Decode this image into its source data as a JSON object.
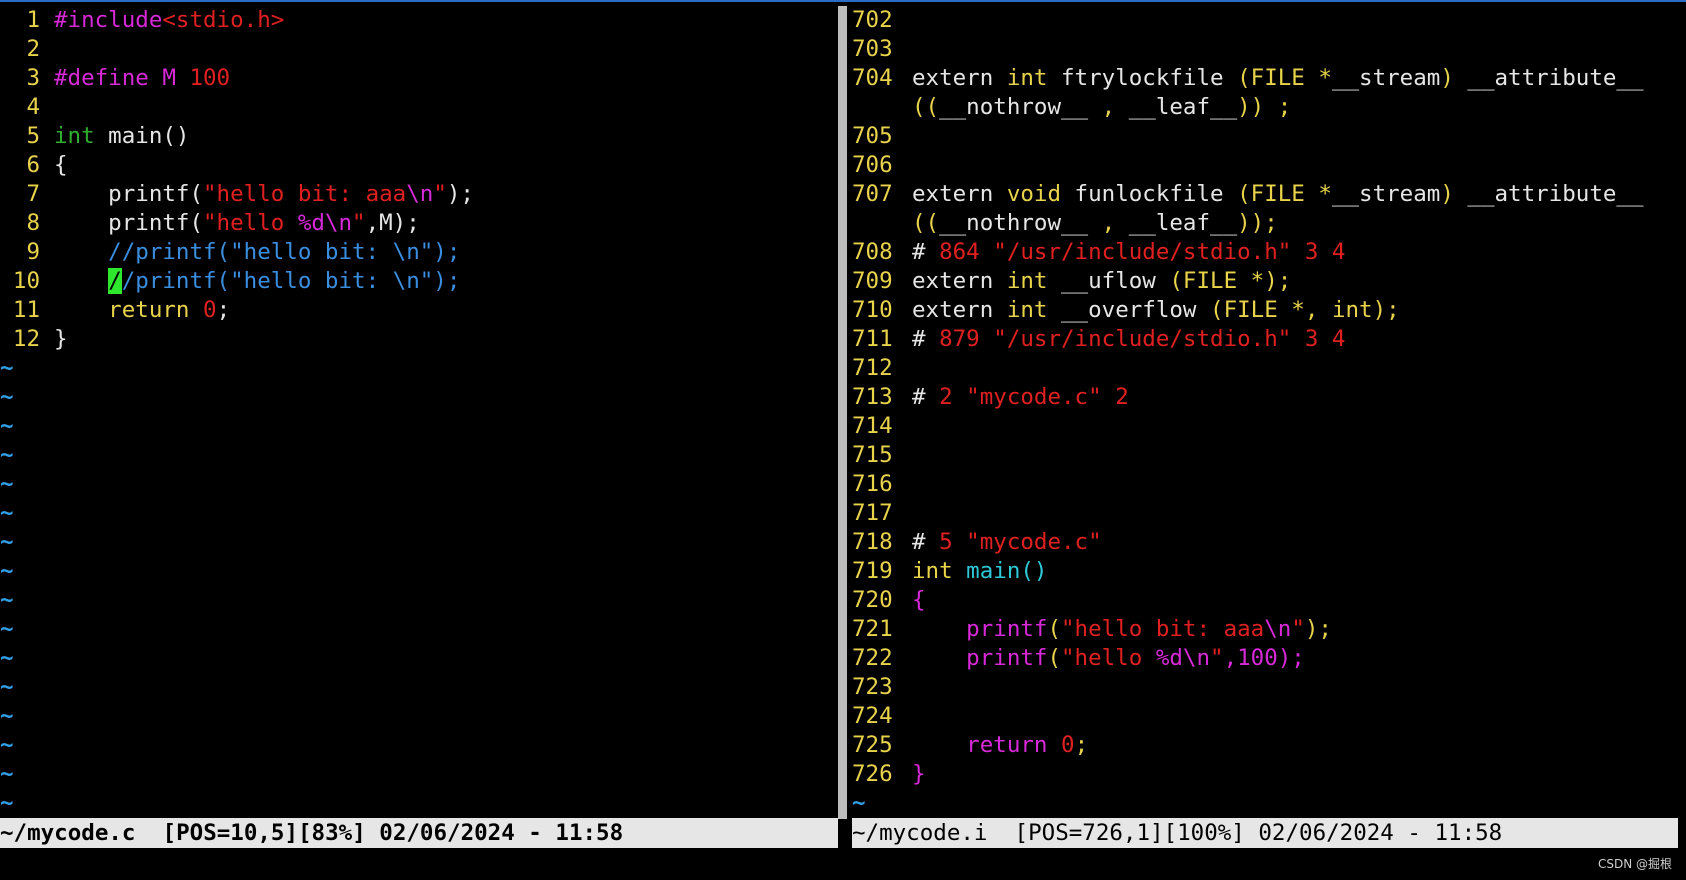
{
  "colors": {
    "line_number": "#e8d34a",
    "preproc": "#d829d8",
    "string": "#e02020",
    "type": "#2fae2f",
    "comment": "#3a8ee0",
    "keyword": "#e8d34a",
    "number": "#e02020",
    "func": "#d829d8",
    "cyan": "#2ec8d8",
    "text": "#e6e6e6",
    "tilde": "#32a0e8",
    "cursor": "#2ee82e"
  },
  "left_pane": {
    "lines": [
      {
        "n": "1",
        "tokens": [
          {
            "t": "#include",
            "c": "preproc"
          },
          {
            "t": "<stdio.h>",
            "c": "string"
          }
        ]
      },
      {
        "n": "2",
        "tokens": []
      },
      {
        "n": "3",
        "tokens": [
          {
            "t": "#define ",
            "c": "preproc"
          },
          {
            "t": "M ",
            "c": "preproc"
          },
          {
            "t": "100",
            "c": "string"
          }
        ]
      },
      {
        "n": "4",
        "tokens": []
      },
      {
        "n": "5",
        "tokens": [
          {
            "t": "int",
            "c": "type"
          },
          {
            "t": " main()",
            "c": "text"
          }
        ]
      },
      {
        "n": "6",
        "tokens": [
          {
            "t": "{",
            "c": "text"
          }
        ]
      },
      {
        "n": "7",
        "tokens": [
          {
            "t": "    printf(",
            "c": "text"
          },
          {
            "t": "\"hello bit: aaa",
            "c": "string"
          },
          {
            "t": "\\n",
            "c": "preproc"
          },
          {
            "t": "\"",
            "c": "string"
          },
          {
            "t": ");",
            "c": "text"
          }
        ]
      },
      {
        "n": "8",
        "tokens": [
          {
            "t": "    printf(",
            "c": "text"
          },
          {
            "t": "\"hello ",
            "c": "string"
          },
          {
            "t": "%d\\n",
            "c": "preproc"
          },
          {
            "t": "\"",
            "c": "string"
          },
          {
            "t": ",M);",
            "c": "text"
          }
        ]
      },
      {
        "n": "9",
        "tokens": [
          {
            "t": "    //printf(\"hello bit: \\n\");",
            "c": "comment"
          }
        ]
      },
      {
        "n": "10",
        "tokens": [
          {
            "t": "    ",
            "c": "text"
          },
          {
            "t": "/",
            "c": "cursor"
          },
          {
            "t": "/printf(\"hello bit: \\n\");",
            "c": "comment"
          }
        ]
      },
      {
        "n": "11",
        "tokens": [
          {
            "t": "    return ",
            "c": "keyword"
          },
          {
            "t": "0",
            "c": "string"
          },
          {
            "t": ";",
            "c": "text"
          }
        ]
      },
      {
        "n": "12",
        "tokens": [
          {
            "t": "}",
            "c": "text"
          }
        ]
      }
    ],
    "tilde_count": 16,
    "status": "~/mycode.c  [POS=10,5][83%] 02/06/2024 - 11:58"
  },
  "right_pane": {
    "lines": [
      {
        "n": "702",
        "tokens": []
      },
      {
        "n": "703",
        "tokens": []
      },
      {
        "n": "704",
        "tokens": [
          {
            "t": "extern ",
            "c": "text"
          },
          {
            "t": "int",
            "c": "keyword"
          },
          {
            "t": " ftrylockfile ",
            "c": "text"
          },
          {
            "t": "(FILE *",
            "c": "keyword"
          },
          {
            "t": "__stream",
            "c": "text"
          },
          {
            "t": ") ",
            "c": "keyword"
          },
          {
            "t": "__attribute__",
            "c": "text"
          }
        ]
      },
      {
        "n": "",
        "tokens": [
          {
            "t": "((",
            "c": "keyword"
          },
          {
            "t": "__nothrow__",
            "c": "text"
          },
          {
            "t": " , ",
            "c": "keyword"
          },
          {
            "t": "__leaf__",
            "c": "text"
          },
          {
            "t": ")) ;",
            "c": "keyword"
          }
        ]
      },
      {
        "n": "705",
        "tokens": []
      },
      {
        "n": "706",
        "tokens": []
      },
      {
        "n": "707",
        "tokens": [
          {
            "t": "extern ",
            "c": "text"
          },
          {
            "t": "void",
            "c": "keyword"
          },
          {
            "t": " funlockfile ",
            "c": "text"
          },
          {
            "t": "(FILE *",
            "c": "keyword"
          },
          {
            "t": "__stream",
            "c": "text"
          },
          {
            "t": ") ",
            "c": "keyword"
          },
          {
            "t": "__attribute__",
            "c": "text"
          }
        ]
      },
      {
        "n": "",
        "tokens": [
          {
            "t": "((",
            "c": "keyword"
          },
          {
            "t": "__nothrow__",
            "c": "text"
          },
          {
            "t": " , ",
            "c": "keyword"
          },
          {
            "t": "__leaf__",
            "c": "text"
          },
          {
            "t": "));",
            "c": "keyword"
          }
        ]
      },
      {
        "n": "708",
        "tokens": [
          {
            "t": "# ",
            "c": "text"
          },
          {
            "t": "864 \"/usr/include/stdio.h\" 3 4",
            "c": "string"
          }
        ]
      },
      {
        "n": "709",
        "tokens": [
          {
            "t": "extern ",
            "c": "text"
          },
          {
            "t": "int",
            "c": "keyword"
          },
          {
            "t": " __uflow ",
            "c": "text"
          },
          {
            "t": "(FILE *);",
            "c": "keyword"
          }
        ]
      },
      {
        "n": "710",
        "tokens": [
          {
            "t": "extern ",
            "c": "text"
          },
          {
            "t": "int",
            "c": "keyword"
          },
          {
            "t": " __overflow ",
            "c": "text"
          },
          {
            "t": "(FILE *, int);",
            "c": "keyword"
          }
        ]
      },
      {
        "n": "711",
        "tokens": [
          {
            "t": "# ",
            "c": "text"
          },
          {
            "t": "879 \"/usr/include/stdio.h\" 3 4",
            "c": "string"
          }
        ]
      },
      {
        "n": "712",
        "tokens": []
      },
      {
        "n": "713",
        "tokens": [
          {
            "t": "# ",
            "c": "text"
          },
          {
            "t": "2 \"mycode.c\" 2",
            "c": "string"
          }
        ]
      },
      {
        "n": "714",
        "tokens": []
      },
      {
        "n": "715",
        "tokens": []
      },
      {
        "n": "716",
        "tokens": []
      },
      {
        "n": "717",
        "tokens": []
      },
      {
        "n": "718",
        "tokens": [
          {
            "t": "# ",
            "c": "text"
          },
          {
            "t": "5 \"mycode.c\"",
            "c": "string"
          }
        ]
      },
      {
        "n": "719",
        "tokens": [
          {
            "t": "int",
            "c": "keyword"
          },
          {
            "t": " main()",
            "c": "cyan"
          }
        ]
      },
      {
        "n": "720",
        "tokens": [
          {
            "t": "{",
            "c": "func"
          }
        ]
      },
      {
        "n": "721",
        "tokens": [
          {
            "t": "    printf",
            "c": "func"
          },
          {
            "t": "(",
            "c": "keyword"
          },
          {
            "t": "\"hello bit: aaa",
            "c": "string"
          },
          {
            "t": "\\n",
            "c": "func"
          },
          {
            "t": "\"",
            "c": "string"
          },
          {
            "t": ");",
            "c": "keyword"
          }
        ]
      },
      {
        "n": "722",
        "tokens": [
          {
            "t": "    printf",
            "c": "func"
          },
          {
            "t": "(",
            "c": "keyword"
          },
          {
            "t": "\"hello ",
            "c": "string"
          },
          {
            "t": "%d\\n",
            "c": "func"
          },
          {
            "t": "\"",
            "c": "string"
          },
          {
            "t": ",100);",
            "c": "func"
          }
        ]
      },
      {
        "n": "723",
        "tokens": []
      },
      {
        "n": "724",
        "tokens": []
      },
      {
        "n": "725",
        "tokens": [
          {
            "t": "    return ",
            "c": "func"
          },
          {
            "t": "0",
            "c": "string"
          },
          {
            "t": ";",
            "c": "keyword"
          }
        ]
      },
      {
        "n": "726",
        "tokens": [
          {
            "t": "}",
            "c": "func"
          }
        ]
      }
    ],
    "tilde_count": 1,
    "status": "~/mycode.i  [POS=726,1][100%] 02/06/2024 - 11:58"
  },
  "watermark": "CSDN @掘根"
}
